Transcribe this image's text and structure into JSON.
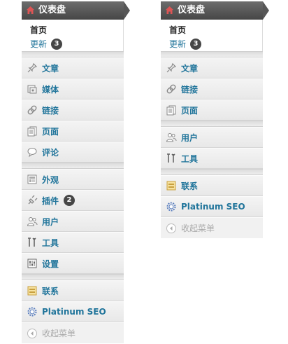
{
  "left": {
    "dashboard_title": "仪表盘",
    "home_label": "首页",
    "updates_label": "更新",
    "updates_count": "3",
    "items": [
      {
        "label": "文章"
      },
      {
        "label": "媒体"
      },
      {
        "label": "链接"
      },
      {
        "label": "页面"
      },
      {
        "label": "评论"
      },
      {
        "label": "外观"
      },
      {
        "label": "插件",
        "badge": "2"
      },
      {
        "label": "用户"
      },
      {
        "label": "工具"
      },
      {
        "label": "设置"
      },
      {
        "label": "联系"
      },
      {
        "label": "Platinum SEO"
      }
    ],
    "collapse_label": "收起菜单"
  },
  "right": {
    "dashboard_title": "仪表盘",
    "home_label": "首页",
    "updates_label": "更新",
    "updates_count": "3",
    "items": [
      {
        "label": "文章"
      },
      {
        "label": "链接"
      },
      {
        "label": "页面"
      },
      {
        "label": "用户"
      },
      {
        "label": "工具"
      },
      {
        "label": "联系"
      },
      {
        "label": "Platinum SEO"
      }
    ],
    "collapse_label": "收起菜单"
  },
  "icons": [
    "home-icon",
    "pin-icon",
    "media-icon",
    "link-icon",
    "page-icon",
    "comment-icon",
    "appearance-icon",
    "plugin-icon",
    "users-icon",
    "tools-icon",
    "settings-icon",
    "contact-icon",
    "gear-icon",
    "collapse-arrow-icon"
  ],
  "colors": {
    "link": "#21759b",
    "header": "#464646",
    "badge": "#464646",
    "contact_icon": "#c8a040",
    "seo_icon": "#5b7fbf"
  }
}
